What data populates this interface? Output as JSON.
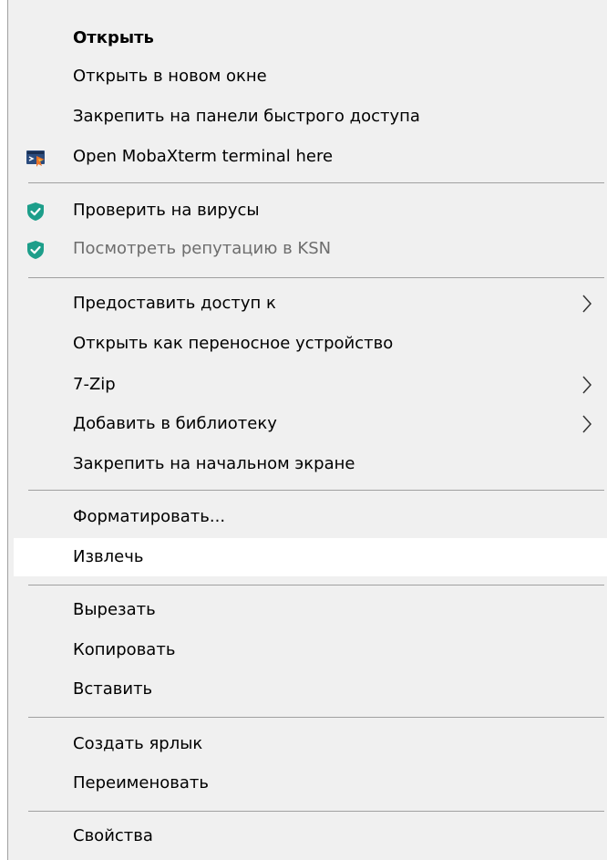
{
  "menu": {
    "items": [
      {
        "label": "Открыть"
      },
      {
        "label": "Открыть в новом окне"
      },
      {
        "label": "Закрепить на панели быстрого доступа"
      },
      {
        "label": "Open MobaXterm terminal here",
        "icon": "mobaxterm-icon"
      },
      {
        "label": "Проверить на вирусы",
        "icon": "kaspersky-shield-icon"
      },
      {
        "label": "Посмотреть репутацию в KSN",
        "icon": "kaspersky-shield-icon"
      },
      {
        "label": "Предоставить доступ к",
        "submenu": true
      },
      {
        "label": "Открыть как переносное устройство"
      },
      {
        "label": "7-Zip",
        "submenu": true
      },
      {
        "label": "Добавить в библиотеку",
        "submenu": true
      },
      {
        "label": "Закрепить на начальном экране"
      },
      {
        "label": "Форматировать..."
      },
      {
        "label": "Извлечь"
      },
      {
        "label": "Вырезать"
      },
      {
        "label": "Копировать"
      },
      {
        "label": "Вставить"
      },
      {
        "label": "Создать ярлык"
      },
      {
        "label": "Переименовать"
      },
      {
        "label": "Свойства"
      }
    ]
  },
  "colors": {
    "menu_bg": "#f0f0f0",
    "hover_bg": "#ffffff",
    "separator": "#a0a0a0",
    "disabled_text": "#6d6d6d",
    "shield": "#1d9e8a"
  }
}
